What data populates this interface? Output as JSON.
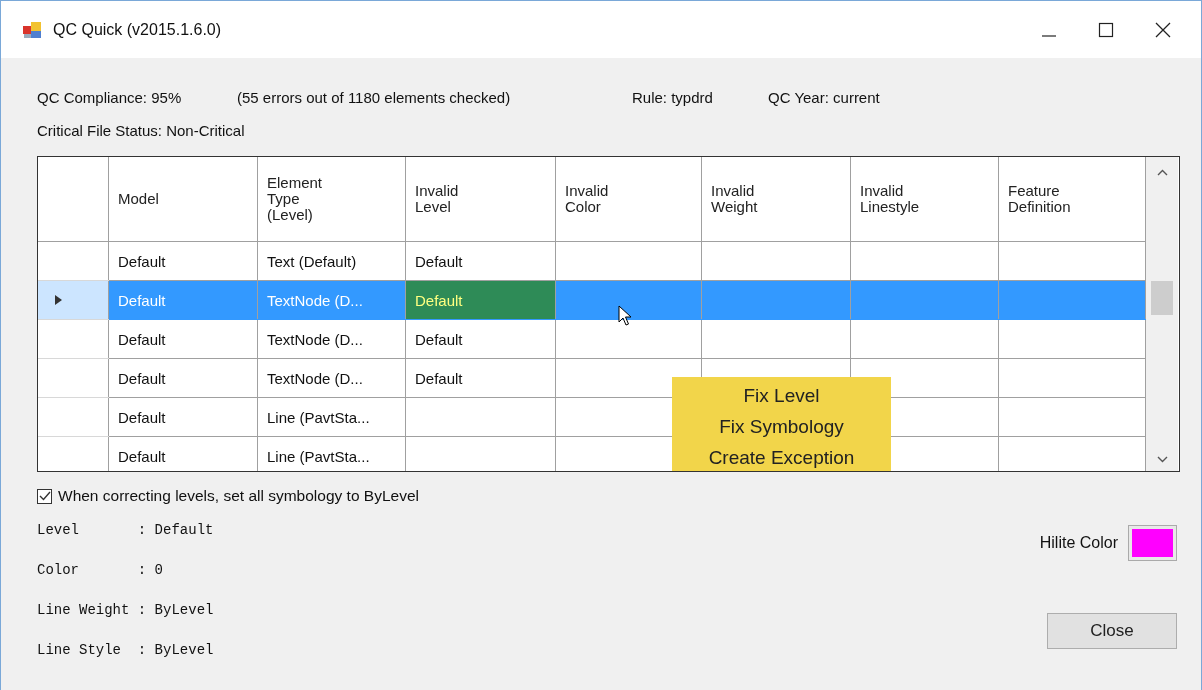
{
  "window": {
    "title": "QC Quick (v2015.1.6.0)"
  },
  "summary": [
    {
      "text": "QC Compliance: 95%"
    },
    {
      "text": "(55 errors out of 1180 elements checked)"
    },
    {
      "text": "Rule: typdrd"
    },
    {
      "text": "QC Year: current"
    }
  ],
  "file_status": "Critical File Status: Non-Critical",
  "table": {
    "columns": [
      "Model",
      "Element\nType\n(Level)",
      "Invalid\nLevel",
      "Invalid\nColor",
      "Invalid\nWeight",
      "Invalid\nLinestyle",
      "Feature\nDefinition"
    ],
    "rows": [
      {
        "selected": false,
        "cells": [
          {
            "text": "Default",
            "current": false
          },
          {
            "text": "Text (Default)",
            "current": false
          },
          {
            "text": "Default",
            "current": false
          }
        ]
      },
      {
        "selected": true,
        "cells": [
          {
            "text": "Default",
            "current": false
          },
          {
            "text": "TextNode (D...",
            "current": false
          },
          {
            "text": "Default",
            "current": true
          }
        ]
      },
      {
        "selected": false,
        "cells": [
          {
            "text": "Default",
            "current": false
          },
          {
            "text": "TextNode (D...",
            "current": false
          },
          {
            "text": "Default",
            "current": false
          }
        ]
      },
      {
        "selected": false,
        "cells": [
          {
            "text": "Default",
            "current": false
          },
          {
            "text": "TextNode (D...",
            "current": false
          },
          {
            "text": "Default",
            "current": false
          }
        ]
      },
      {
        "selected": false,
        "cells": [
          {
            "text": "Default",
            "current": false
          },
          {
            "text": "Line (PavtSta...",
            "current": false
          }
        ]
      },
      {
        "selected": false,
        "cells": [
          {
            "text": "Default",
            "current": false
          },
          {
            "text": "Line (PavtSta...",
            "current": false
          }
        ]
      }
    ]
  },
  "context_menu": [
    "Fix Level",
    "Fix Symbology",
    "Create Exception"
  ],
  "option": {
    "label": "When correcting levels, set all symbology to ByLevel",
    "checked": true
  },
  "details": [
    "Level       : Default",
    "Color       : 0",
    "Line Weight : ByLevel",
    "Line Style  : ByLevel"
  ],
  "hilite": {
    "label": "Hilite Color",
    "color": "#ff00ff"
  },
  "buttons": [
    "Close"
  ]
}
